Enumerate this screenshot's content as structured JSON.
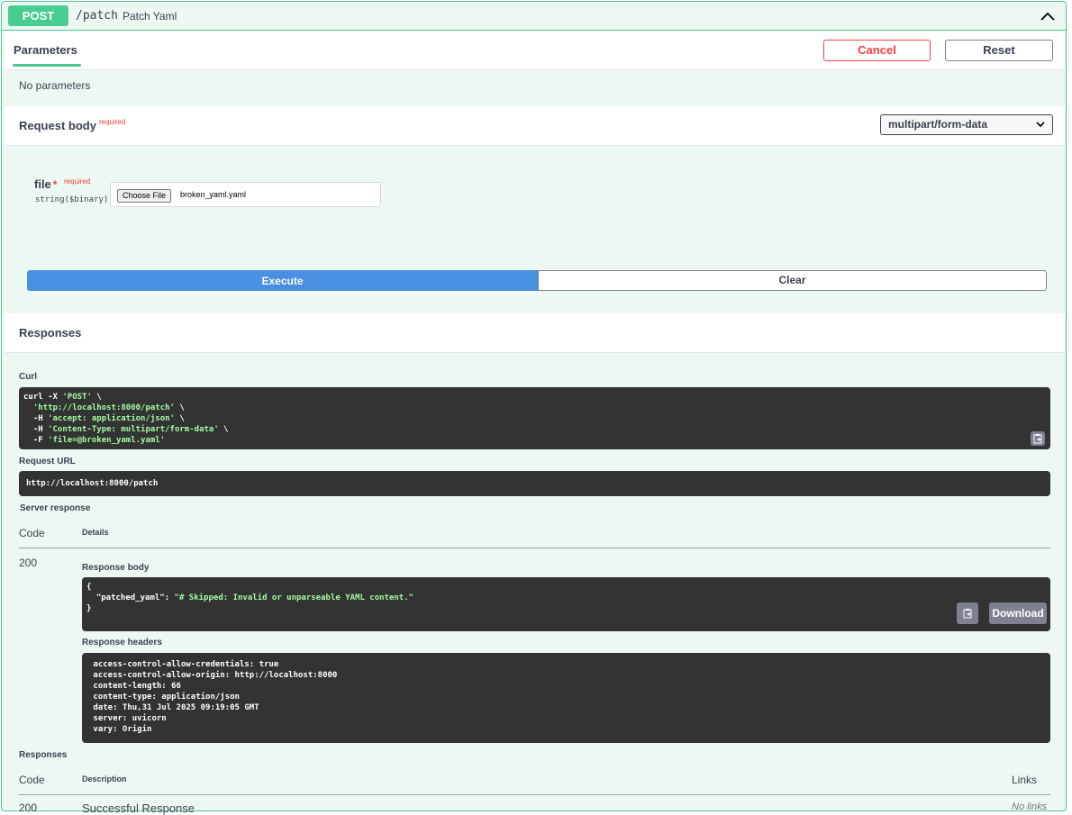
{
  "operation": {
    "method": "POST",
    "path": "/patch",
    "summary": "Patch Yaml"
  },
  "parameters": {
    "tab_label": "Parameters",
    "cancel_label": "Cancel",
    "reset_label": "Reset",
    "empty_text": "No parameters"
  },
  "request_body": {
    "title": "Request body",
    "required_label": "required",
    "content_type": "multipart/form-data",
    "field_name": "file",
    "field_required_star": "*",
    "field_required_label": "required",
    "field_type": "string($binary)",
    "choose_file_label": "Choose File",
    "file_name": "broken_yaml.yaml"
  },
  "actions": {
    "execute_label": "Execute",
    "clear_label": "Clear"
  },
  "responses": {
    "title": "Responses",
    "curl_label": "Curl",
    "curl_lines": [
      {
        "a": "curl -X ",
        "s": "'POST'",
        "b": " \\"
      },
      {
        "a": "  ",
        "s": "'http://localhost:8000/patch'",
        "b": " \\"
      },
      {
        "a": "  -H ",
        "s": "'accept: application/json'",
        "b": " \\"
      },
      {
        "a": "  -H ",
        "s": "'Content-Type: multipart/form-data'",
        "b": " \\"
      },
      {
        "a": "  -F ",
        "s": "'file=@broken_yaml.yaml'",
        "b": ""
      }
    ],
    "request_url_label": "Request URL",
    "request_url": "http://localhost:8000/patch",
    "server_response_label": "Server response",
    "code_header": "Code",
    "details_header": "Details",
    "status_code": "200",
    "response_body_label": "Response body",
    "response_body_lines": [
      {
        "a": "{",
        "s": "",
        "b": ""
      },
      {
        "a": "  \"patched_yaml\": ",
        "s": "\"# Skipped: Invalid or unparseable YAML content.\"",
        "b": ""
      },
      {
        "a": "}",
        "s": "",
        "b": ""
      }
    ],
    "download_label": "Download",
    "response_headers_label": "Response headers",
    "response_headers": [
      " access-control-allow-credentials: true",
      " access-control-allow-origin: http://localhost:8000",
      " content-length: 66",
      " content-type: application/json",
      " date: Thu,31 Jul 2025 09:19:05 GMT",
      " server: uvicorn",
      " vary: Origin"
    ],
    "responses_label": "Responses",
    "resp_code_header": "Code",
    "resp_description_header": "Description",
    "resp_links_header": "Links",
    "row_code": "200",
    "row_description": "Successful Response",
    "row_links": "No links"
  },
  "colors": {
    "post_green": "#49cc90",
    "execute_blue": "#4990e2",
    "cancel_red": "#f93e3e",
    "code_bg": "#333333"
  }
}
